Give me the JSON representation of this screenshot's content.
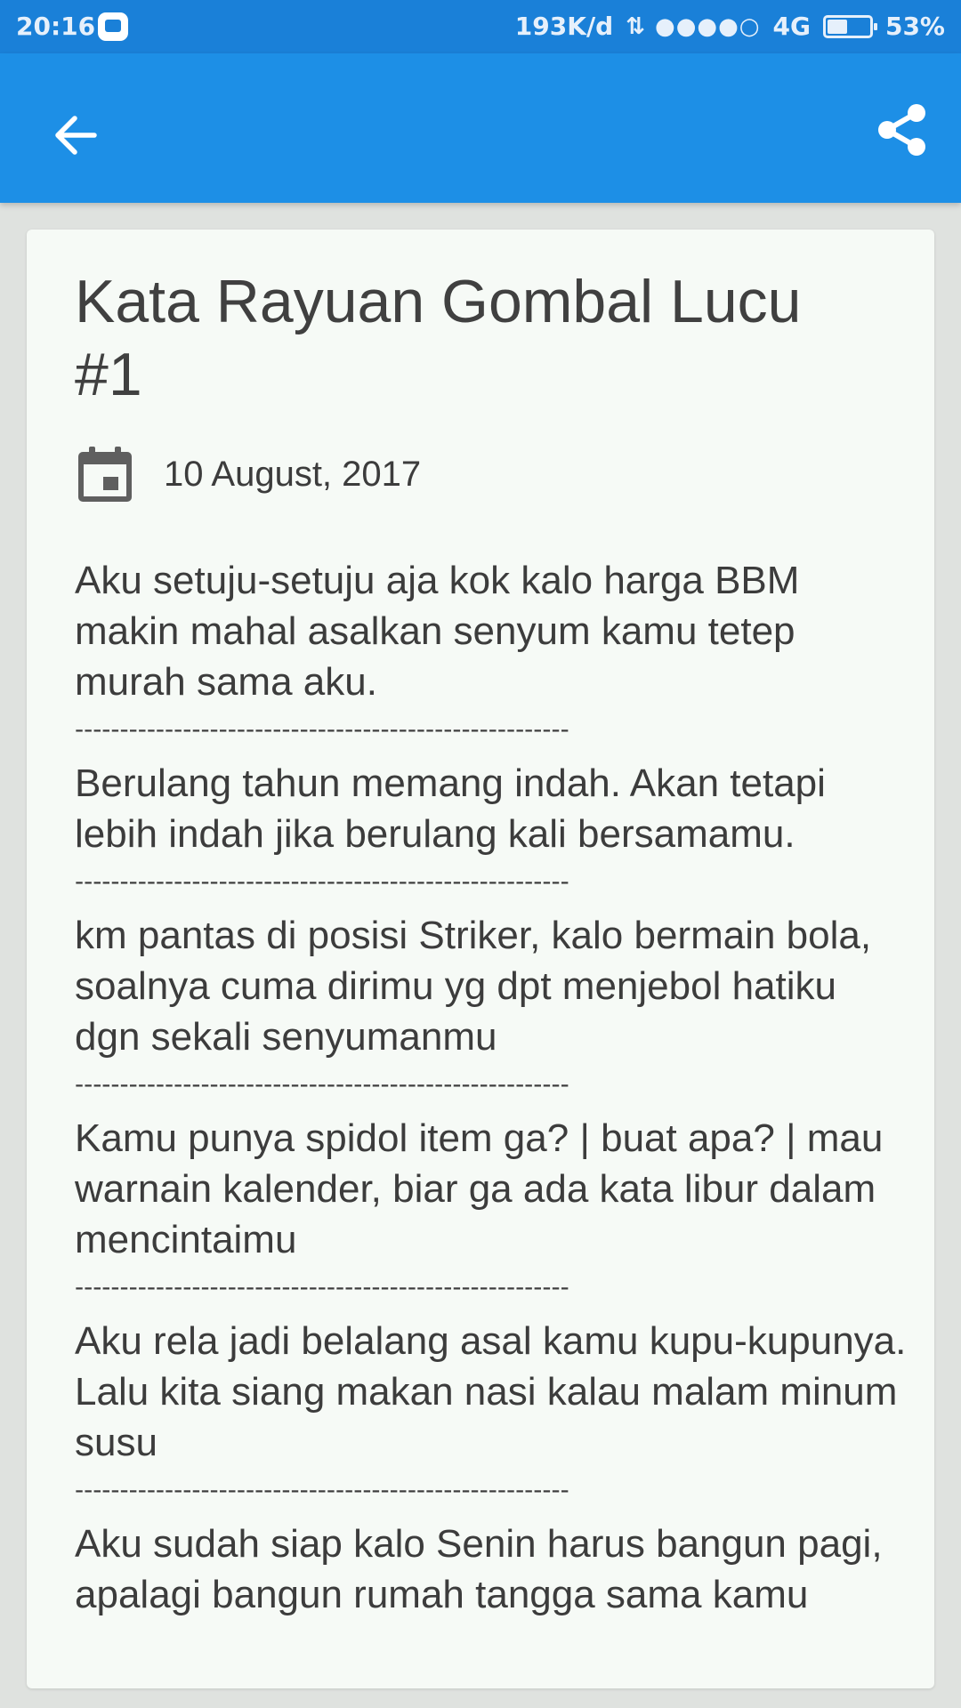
{
  "status_bar": {
    "time": "20:16",
    "network_speed": "193K/d",
    "signal": "⇅ ●●●●○",
    "network_type": "4G",
    "battery_percent_label": "53%",
    "battery_level": 0.53
  },
  "app_bar": {
    "back_icon": "arrow-back-icon",
    "share_icon": "share-icon",
    "color": "#1d8fe6"
  },
  "article": {
    "title": "Kata Rayuan Gombal Lucu #1",
    "date": "10 August, 2017",
    "separator": "-------------------------------------------------------",
    "paragraphs": [
      "Aku setuju-setuju aja kok kalo harga BBM makin mahal asalkan senyum kamu tetep murah sama aku.",
      "Berulang tahun memang indah. Akan tetapi lebih indah jika berulang kali bersamamu.",
      "km pantas di posisi Striker, kalo bermain bola, soalnya cuma dirimu yg dpt menjebol hatiku dgn sekali senyumanmu",
      "Kamu punya spidol item ga? | buat apa? | mau warnain kalender, biar ga ada kata libur dalam mencintaimu",
      "Aku rela jadi belalang asal kamu kupu-kupunya. Lalu kita siang makan nasi kalau malam minum susu",
      "Aku sudah siap kalo Senin harus bangun pagi, apalagi bangun rumah tangga sama kamu"
    ]
  }
}
